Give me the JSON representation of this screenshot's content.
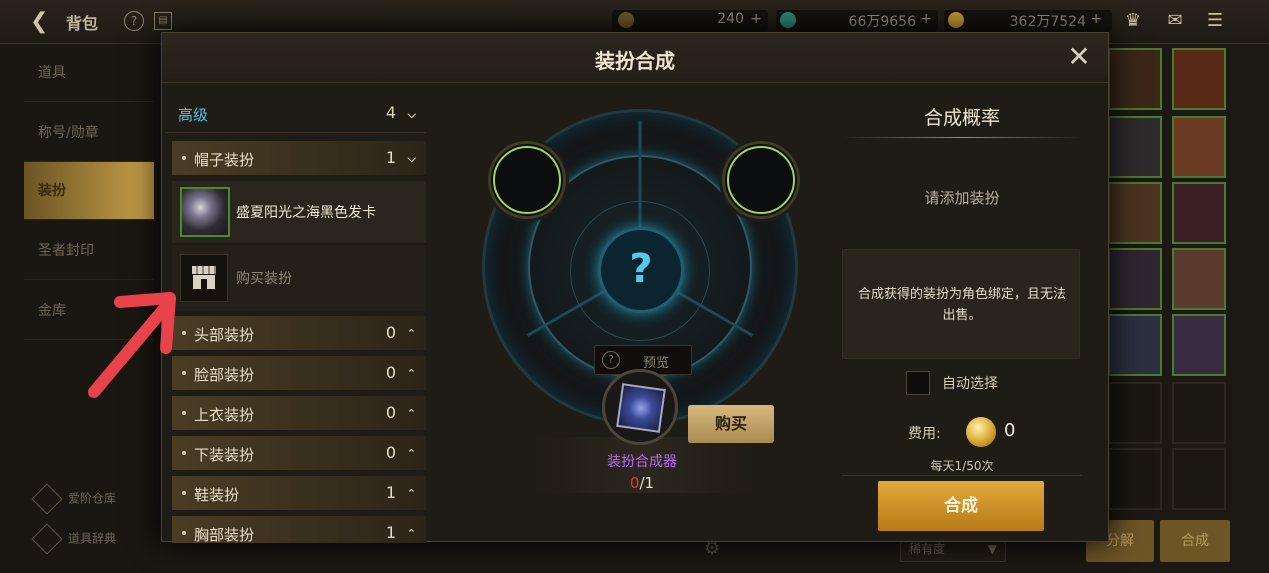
{
  "topbar": {
    "title": "背包",
    "currency1": "240",
    "currency2": "66万9656",
    "currency3": "362万7524"
  },
  "left_nav": {
    "items": [
      "道具",
      "称号/勋章",
      "装扮",
      "圣者封印",
      "金库"
    ],
    "bottom": [
      "爱阶仓库",
      "道具辞典"
    ]
  },
  "modal": {
    "title": "装扮合成",
    "close_icon": "close-icon"
  },
  "list": {
    "header": {
      "label": "高级",
      "count": "4"
    },
    "categories": [
      {
        "label": "帽子装扮",
        "count": "1",
        "expanded": true
      },
      {
        "label": "头部装扮",
        "count": "0"
      },
      {
        "label": "脸部装扮",
        "count": "0"
      },
      {
        "label": "上衣装扮",
        "count": "0"
      },
      {
        "label": "下装装扮",
        "count": "0"
      },
      {
        "label": "鞋装扮",
        "count": "1"
      },
      {
        "label": "胸部装扮",
        "count": "1"
      }
    ],
    "item": {
      "name": "盛夏阳光之海黑色发卡"
    },
    "buy_row": {
      "label": "购买装扮"
    }
  },
  "center": {
    "question": "?",
    "preview": "预览",
    "fuser_name": "装扮合成器",
    "fuser_have": "0",
    "fuser_need": "/1",
    "buy": "购买"
  },
  "right": {
    "rate_title": "合成概率",
    "rate_value": "请添加装扮",
    "notice": "合成获得的装扮为角色绑定，且无法出售。",
    "auto_select": "自动选择",
    "cost_label": "费用:",
    "cost_value": "0",
    "daily": "每天1/50次",
    "compose": "合成"
  },
  "bottom": {
    "rarity": "稀有度",
    "decompose": "分解",
    "compose": "合成"
  },
  "colors": {
    "accent_cyan": "#4fc4e8",
    "compose_button": "#e2a83b",
    "fuser_purple": "#b668f2",
    "count_red": "#ea3a2e",
    "annotation_arrow": "#e8434b"
  }
}
